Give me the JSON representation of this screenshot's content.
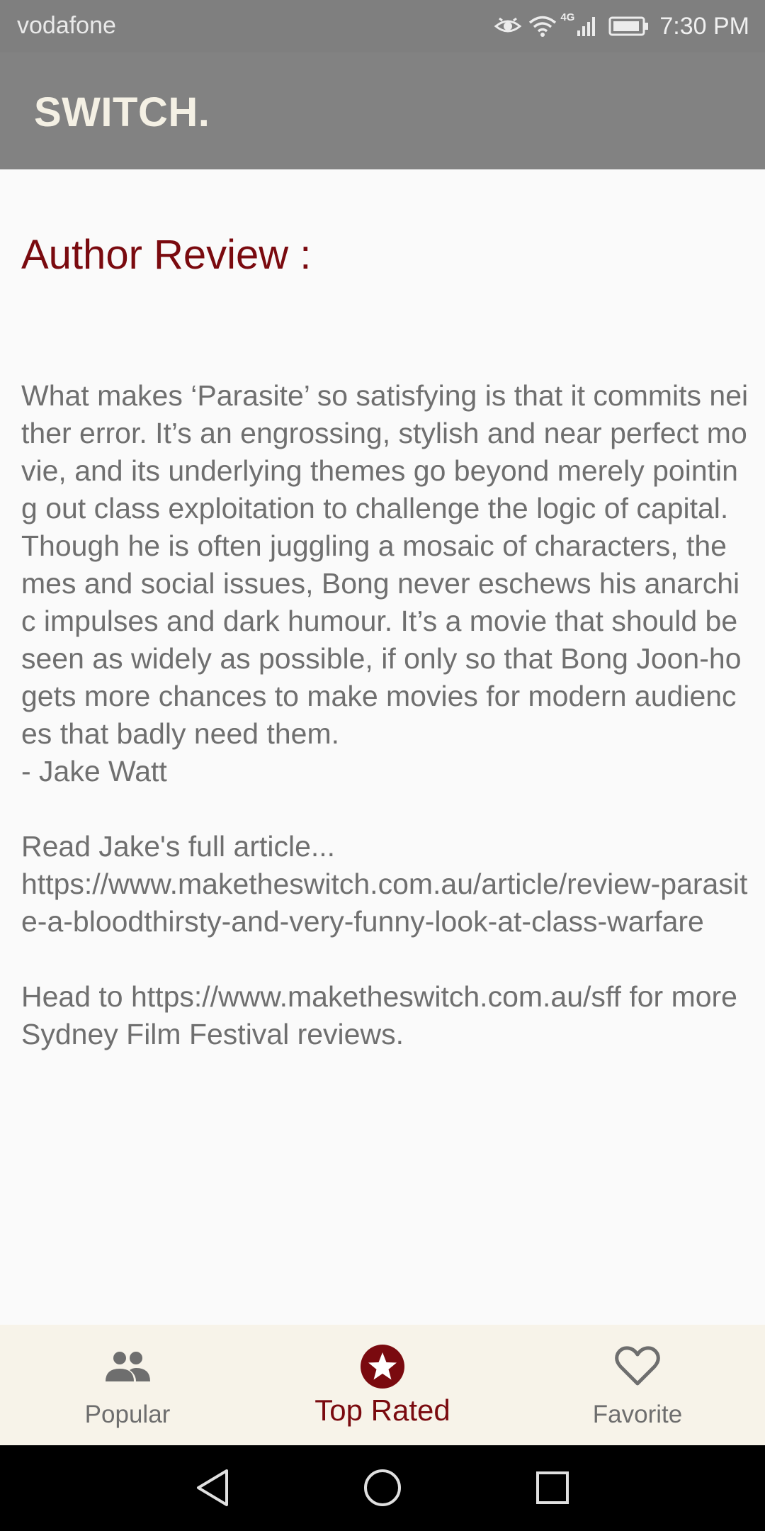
{
  "status_bar": {
    "carrier": "vodafone",
    "network_type": "4G",
    "time": "7:30 PM",
    "icons": [
      "eye-icon",
      "wifi-icon",
      "cellular-signal-icon",
      "battery-icon"
    ]
  },
  "app_bar": {
    "title": "SWITCH."
  },
  "review": {
    "heading": "Author Review :",
    "body": "What makes ‘Parasite’ so satisfying is that it commits neither error. It’s an engrossing, stylish and near perfect movie, and its underlying themes go beyond merely pointing out class exploitation to challenge the logic of capital. Though he is often juggling a mosaic of characters, themes and social issues, Bong never eschews his anarchic impulses and dark humour. It’s a movie that should be seen as widely as possible, if only so that Bong Joon-ho gets more chances to make movies for modern audiences that badly need them.\n- Jake Watt\n\nRead Jake's full article...\nhttps://www.maketheswitch.com.au/article/review-parasite-a-bloodthirsty-and-very-funny-look-at-class-warfare\n\nHead to https://www.maketheswitch.com.au/sff for more Sydney Film Festival reviews."
  },
  "bottom_nav": {
    "items": [
      {
        "label": "Popular",
        "icon": "people-icon",
        "active": false
      },
      {
        "label": "Top Rated",
        "icon": "star-circle-icon",
        "active": true
      },
      {
        "label": "Favorite",
        "icon": "heart-outline-icon",
        "active": false
      }
    ]
  },
  "system_nav": {
    "buttons": [
      "back-icon",
      "home-icon",
      "recents-icon"
    ]
  },
  "colors": {
    "status_bar": "#7f7f7f",
    "app_bar": "#828282",
    "title_text": "#f4f0e4",
    "accent": "#7a0a0f",
    "body_text": "#6f6f6f",
    "content_bg": "#fafafa",
    "bottom_nav_bg": "#f7f3e9",
    "inactive_nav": "#6e6e6e"
  }
}
